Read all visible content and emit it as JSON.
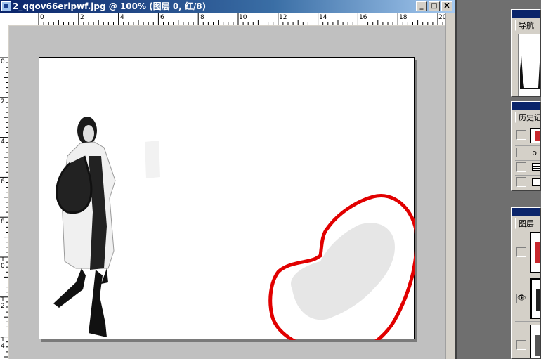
{
  "window": {
    "title": "2_qqov66erlpwf.jpg @ 100% (图层 0, 红/8)",
    "buttons": [
      "_",
      "□",
      "X"
    ]
  },
  "ruler": {
    "h_labels": [
      "0",
      "2",
      "4",
      "6",
      "8",
      "10",
      "12",
      "14",
      "16",
      "18",
      "20"
    ],
    "v_labels": [
      "0",
      "2",
      "4",
      "6",
      "8",
      "1\n0",
      "1\n2",
      "1\n4"
    ]
  },
  "panels": {
    "navigator_tab": "导航",
    "history_tab": "历史记",
    "layers_tab": "图层"
  },
  "colors": {
    "annotation_stroke": "#e10000",
    "selection_fill": "#e6e6e6"
  }
}
